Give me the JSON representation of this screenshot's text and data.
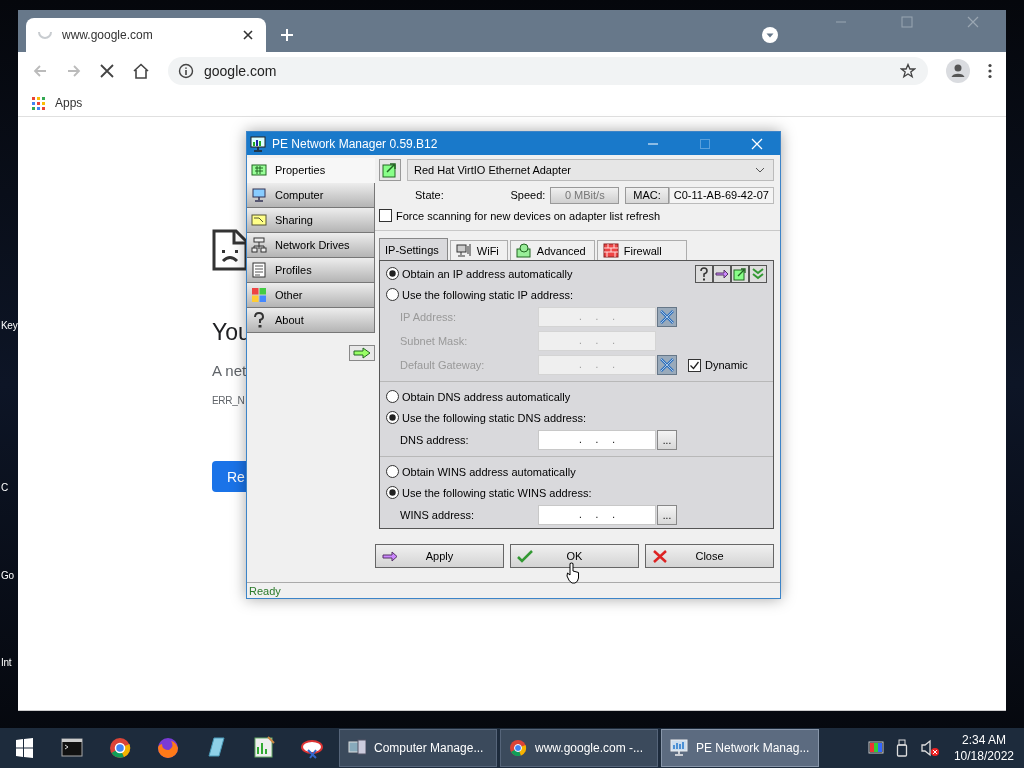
{
  "desktop": {
    "icon_labels": [
      "Key",
      "C",
      "Go",
      "Int"
    ]
  },
  "browser": {
    "tab_title": "www.google.com",
    "address": "google.com",
    "bookmarks": [
      "Apps"
    ],
    "error_page": {
      "heading": "You",
      "message": "A net",
      "code": "ERR_N",
      "button": "Re"
    }
  },
  "dialog": {
    "title": "PE Network Manager 0.59.B12",
    "sidebar": [
      {
        "label": "Properties",
        "selected": true
      },
      {
        "label": "Computer",
        "selected": false
      },
      {
        "label": "Sharing",
        "selected": false
      },
      {
        "label": "Network Drives",
        "selected": false
      },
      {
        "label": "Profiles",
        "selected": false
      },
      {
        "label": "Other",
        "selected": false
      },
      {
        "label": "About",
        "selected": false
      }
    ],
    "adapter": "Red Hat VirtIO Ethernet Adapter",
    "state_label": "State:",
    "speed_label": "Speed:",
    "speed": "0 MBit/s",
    "mac_label": "MAC:",
    "mac": "C0-11-AB-69-42-07",
    "force_scan": {
      "label": "Force scanning for new devices on adapter list refresh",
      "checked": false
    },
    "tabs": [
      {
        "label": "IP-Settings",
        "selected": true
      },
      {
        "label": "WiFi",
        "selected": false
      },
      {
        "label": "Advanced",
        "selected": false
      },
      {
        "label": "Firewall",
        "selected": false
      }
    ],
    "sections": [
      {
        "options": [
          {
            "label": "Obtain an IP address automatically",
            "selected": true
          },
          {
            "label": "Use the following static IP address:",
            "selected": false
          }
        ],
        "fields": [
          {
            "label": "IP Address:",
            "value": ".     .     .",
            "disabled": true,
            "kind": "clear"
          },
          {
            "label": "Subnet Mask:",
            "value": ".     .     .",
            "disabled": true,
            "kind": "plain"
          },
          {
            "label": "Default Gateway:",
            "value": ".     .     .",
            "disabled": true,
            "kind": "clear"
          }
        ],
        "dynamic": {
          "label": "Dynamic",
          "checked": true
        }
      },
      {
        "options": [
          {
            "label": "Obtain DNS address automatically",
            "selected": false
          },
          {
            "label": "Use the following static DNS address:",
            "selected": true
          }
        ],
        "fields": [
          {
            "label": "DNS address:",
            "value": ".     .     .",
            "disabled": false,
            "kind": "browse",
            "button": "..."
          }
        ]
      },
      {
        "options": [
          {
            "label": "Obtain WINS address automatically",
            "selected": false
          },
          {
            "label": "Use the following static WINS address:",
            "selected": true
          }
        ],
        "fields": [
          {
            "label": "WINS address:",
            "value": ".     .     .",
            "disabled": false,
            "kind": "browse",
            "button": "..."
          }
        ]
      }
    ],
    "buttons": [
      {
        "label": "Apply",
        "kind": "apply"
      },
      {
        "label": "OK",
        "kind": "ok"
      },
      {
        "label": "Close",
        "kind": "close"
      }
    ],
    "status": "Ready"
  },
  "taskbar": {
    "tasks": [
      {
        "label": "Computer Manage...",
        "selected": false
      },
      {
        "label": "www.google.com -...",
        "selected": false
      },
      {
        "label": "PE Network Manag...",
        "selected": true
      }
    ],
    "time": "2:34 AM",
    "date": "10/18/2022"
  }
}
